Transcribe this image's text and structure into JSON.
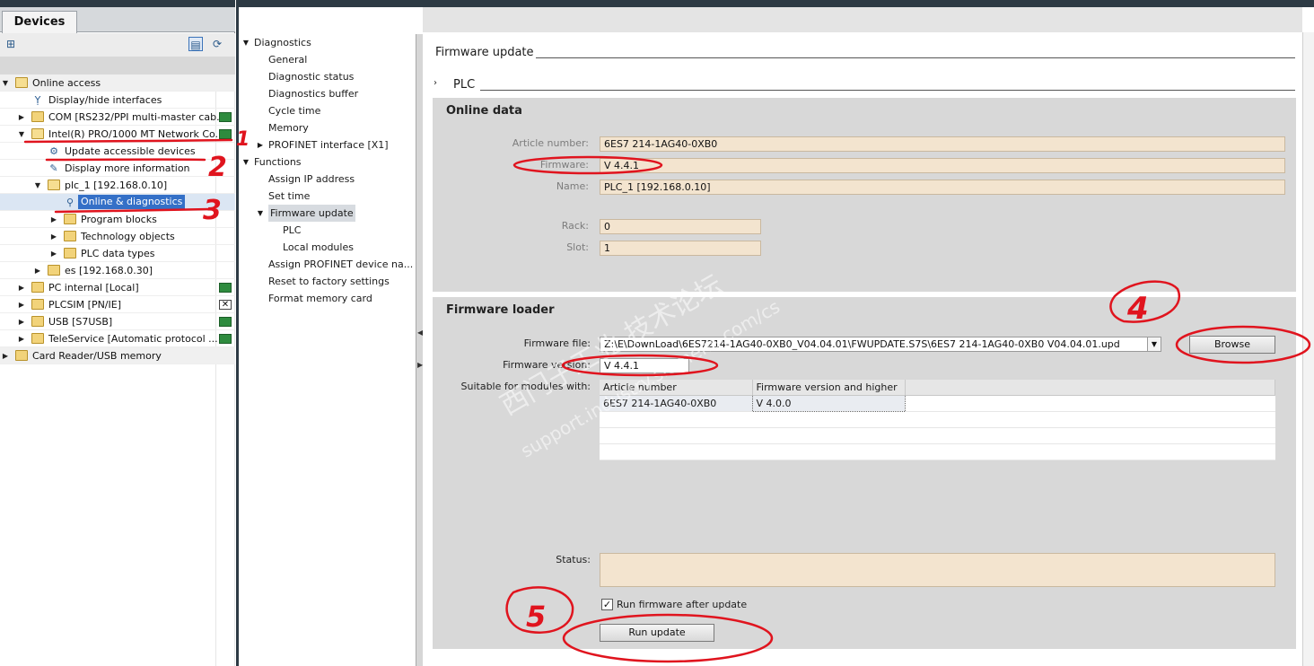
{
  "left_panel": {
    "tab_label": "Devices",
    "tree": [
      {
        "label": "Online access",
        "level": 0,
        "expanded": true
      },
      {
        "label": "Display/hide interfaces",
        "level": 1
      },
      {
        "label": "COM [RS232/PPI multi-master cab...",
        "level": 1,
        "expanded": false
      },
      {
        "label": "Intel(R) PRO/1000 MT Network Co...",
        "level": 1,
        "expanded": true
      },
      {
        "label": "Update accessible devices",
        "level": 2
      },
      {
        "label": "Display more information",
        "level": 2
      },
      {
        "label": "plc_1 [192.168.0.10]",
        "level": 2,
        "expanded": true
      },
      {
        "label": "Online & diagnostics",
        "level": 3,
        "selected": true
      },
      {
        "label": "Program blocks",
        "level": 3,
        "expanded": false
      },
      {
        "label": "Technology objects",
        "level": 3,
        "expanded": false
      },
      {
        "label": "PLC data types",
        "level": 3,
        "expanded": false
      },
      {
        "label": "es [192.168.0.30]",
        "level": 2,
        "expanded": false
      },
      {
        "label": "PC internal [Local]",
        "level": 1,
        "expanded": false
      },
      {
        "label": "PLCSIM [PN/IE]",
        "level": 1,
        "expanded": false
      },
      {
        "label": "USB [S7USB]",
        "level": 1,
        "expanded": false
      },
      {
        "label": "TeleService [Automatic protocol ...",
        "level": 1,
        "expanded": false
      },
      {
        "label": "Card Reader/USB memory",
        "level": 0,
        "expanded": false
      }
    ]
  },
  "nav_panel": {
    "items": [
      {
        "label": "Diagnostics",
        "group": true,
        "expanded": true
      },
      {
        "label": "General"
      },
      {
        "label": "Diagnostic status"
      },
      {
        "label": "Diagnostics buffer"
      },
      {
        "label": "Cycle time"
      },
      {
        "label": "Memory"
      },
      {
        "label": "PROFINET interface [X1]",
        "expandable": true
      },
      {
        "label": "Functions",
        "group": true,
        "expanded": true
      },
      {
        "label": "Assign IP address"
      },
      {
        "label": "Set time"
      },
      {
        "label": "Firmware update",
        "expanded": true,
        "selected": true
      },
      {
        "label": "PLC",
        "level": 2
      },
      {
        "label": "Local modules",
        "level": 2
      },
      {
        "label": "Assign PROFINET device na..."
      },
      {
        "label": "Reset to factory settings"
      },
      {
        "label": "Format memory card"
      }
    ]
  },
  "content": {
    "section_title": "Firmware update",
    "subsection_title": "PLC",
    "online_data": {
      "title": "Online data",
      "article_number_label": "Article number:",
      "article_number": "6ES7 214-1AG40-0XB0",
      "firmware_label": "Firmware:",
      "firmware": "V 4.4.1",
      "name_label": "Name:",
      "name": "PLC_1 [192.168.0.10]",
      "rack_label": "Rack:",
      "rack": "0",
      "slot_label": "Slot:",
      "slot": "1"
    },
    "firmware_loader": {
      "title": "Firmware loader",
      "file_label": "Firmware file:",
      "file_path": "Z:\\E\\DownLoad\\6ES7214-1AG40-0XB0_V04.04.01\\FWUPDATE.S7S\\6ES7 214-1AG40-0XB0 V04.04.01.upd",
      "browse_label": "Browse",
      "version_label": "Firmware version:",
      "version": "V 4.4.1",
      "suitable_label": "Suitable for modules with:",
      "table_headers": [
        "Article number",
        "Firmware version and higher"
      ],
      "table_rows": [
        [
          "6ES7 214-1AG40-0XB0",
          "V 4.0.0"
        ]
      ],
      "status_label": "Status:",
      "status": "",
      "run_after_update_label": "Run firmware after update",
      "run_after_update_checked": true,
      "run_update_label": "Run update"
    }
  },
  "watermark": {
    "line1": "西门子工业 技术论坛",
    "line2": "support.industry.siemens.com/cs"
  },
  "annotations": [
    "1",
    "2",
    "3",
    "4",
    "5"
  ],
  "colors": {
    "selection": "#3470c7",
    "field_readonly": "#f3e4cf",
    "panel_bg": "#d8d8d8",
    "annotation_red": "#e0141e"
  }
}
